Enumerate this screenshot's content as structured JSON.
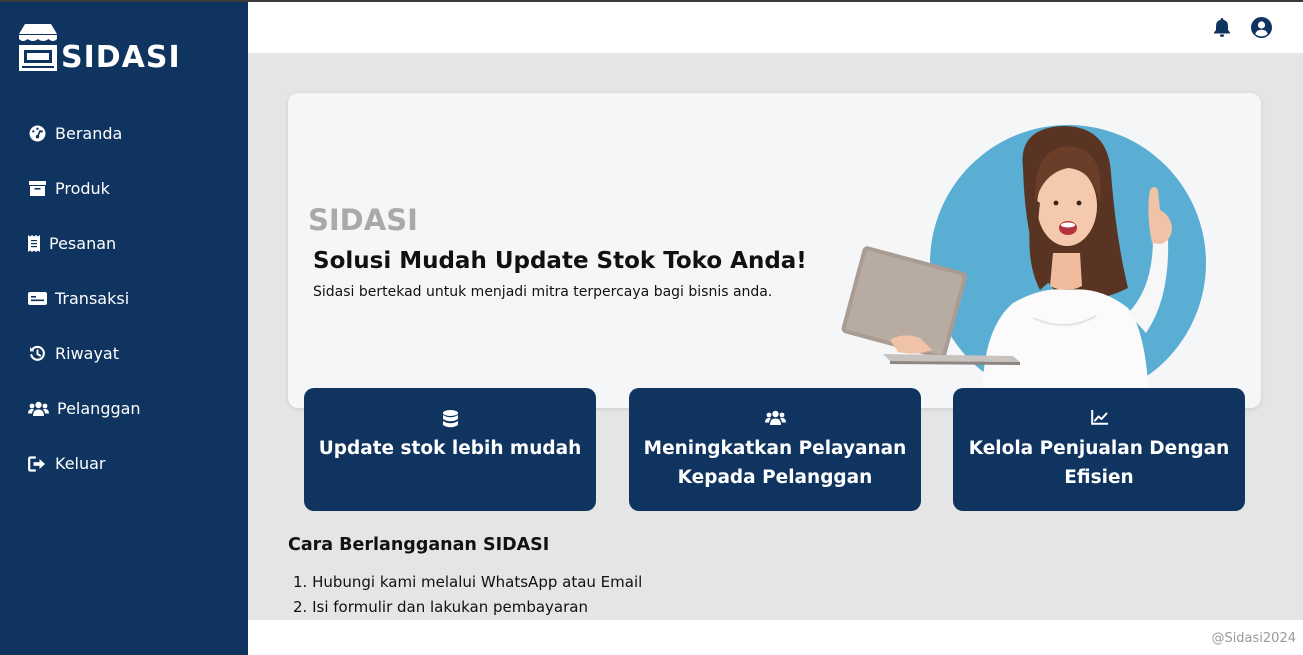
{
  "brand": {
    "logo_text": "SIDASI"
  },
  "sidebar": {
    "items": [
      {
        "label": "Beranda",
        "icon": "dashboard-icon"
      },
      {
        "label": "Produk",
        "icon": "archive-icon"
      },
      {
        "label": "Pesanan",
        "icon": "receipt-icon"
      },
      {
        "label": "Transaksi",
        "icon": "card-icon"
      },
      {
        "label": "Riwayat",
        "icon": "history-icon"
      },
      {
        "label": "Pelanggan",
        "icon": "users-icon"
      },
      {
        "label": "Keluar",
        "icon": "logout-icon"
      }
    ]
  },
  "header": {
    "icons": [
      "bell-icon",
      "user-circle-icon"
    ]
  },
  "hero": {
    "brand": "SIDASI",
    "title": "Solusi Mudah Update Stok Toko Anda!",
    "subtitle": "Sidasi bertekad untuk menjadi mitra terpercaya bagi bisnis anda."
  },
  "features": [
    {
      "title": "Update stok lebih mudah",
      "icon": "database-icon"
    },
    {
      "title": "Meningkatkan Pelayanan Kepada Pelanggan",
      "icon": "users-icon"
    },
    {
      "title": "Kelola Penjualan Dengan Efisien",
      "icon": "chart-line-icon"
    }
  ],
  "subscription": {
    "title": "Cara Berlangganan SIDASI",
    "steps": [
      "1. Hubungi kami melalui WhatsApp atau Email",
      "2. Isi formulir dan lakukan pembayaran"
    ]
  },
  "footer": {
    "copyright": "@Sidasi2024"
  },
  "colors": {
    "primary": "#0f3460",
    "background": "#e5e5e5",
    "hero_circle": "#5aaed3",
    "muted": "#a9a9a9"
  }
}
